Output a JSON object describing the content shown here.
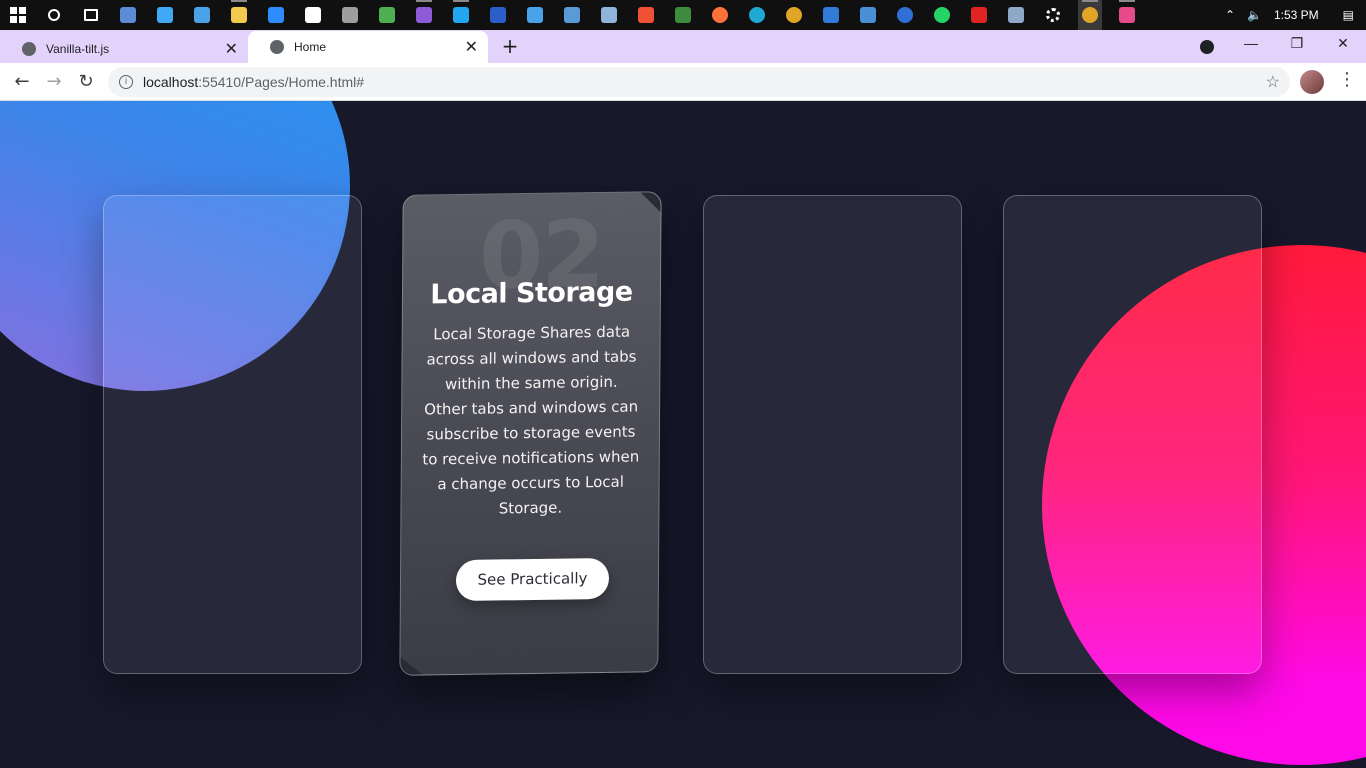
{
  "taskbar": {
    "apps": [
      {
        "icon": "search-icon",
        "color": "#ffffff"
      },
      {
        "icon": "task-view-icon",
        "color": "#ffffff"
      },
      {
        "icon": "calculator-icon",
        "color": "#5b8cd6"
      },
      {
        "icon": "desktop-icon",
        "color": "#3fa9f5"
      },
      {
        "icon": "control-panel-icon",
        "color": "#4aa3e8"
      },
      {
        "icon": "file-explorer-icon",
        "color": "#f2c94c"
      },
      {
        "icon": "zoom-icon",
        "color": "#2d8cff"
      },
      {
        "icon": "app-icon",
        "color": "#ffffff"
      },
      {
        "icon": "usb-icon",
        "color": "#9e9e9e"
      },
      {
        "icon": "paint-icon",
        "color": "#4caf50"
      },
      {
        "icon": "visual-studio-icon",
        "color": "#8e5bd6"
      },
      {
        "icon": "vscode-icon",
        "color": "#23a6f0"
      },
      {
        "icon": "visio-icon",
        "color": "#2b5fc7"
      },
      {
        "icon": "app-icon-2",
        "color": "#4aa3e8"
      },
      {
        "icon": "keyboard-icon",
        "color": "#5b9bd5"
      },
      {
        "icon": "notepad-icon",
        "color": "#8fb3d9"
      },
      {
        "icon": "git-icon",
        "color": "#f05033"
      },
      {
        "icon": "greenshot-icon",
        "color": "#3d8b3d"
      },
      {
        "icon": "firefox-icon",
        "color": "#ff7139"
      },
      {
        "icon": "edge-icon",
        "color": "#1fa8d1"
      },
      {
        "icon": "chrome-icon",
        "color": "#e0a526"
      },
      {
        "icon": "photos-icon",
        "color": "#2f7bd6"
      },
      {
        "icon": "screenshot-icon",
        "color": "#4a8fd6"
      },
      {
        "icon": "messenger-icon",
        "color": "#2f6fd6"
      },
      {
        "icon": "whatsapp-icon",
        "color": "#25d366"
      },
      {
        "icon": "acrobat-icon",
        "color": "#e02424"
      },
      {
        "icon": "remote-desktop-icon",
        "color": "#8fa8c8"
      },
      {
        "icon": "settings-icon",
        "color": "#ffffff"
      },
      {
        "icon": "chrome-icon-active",
        "color": "#e0a526"
      },
      {
        "icon": "paint3d-icon",
        "color": "#e64a8b"
      }
    ],
    "tray": {
      "chevron": "⌃",
      "volume": "🔈",
      "clock": "1:53 PM"
    }
  },
  "browser": {
    "tabs": [
      {
        "title": "Vanilla-tilt.js",
        "active": false
      },
      {
        "title": "Home",
        "active": true
      }
    ],
    "new_tab_label": "+",
    "url_host": "localhost",
    "url_path": ":55410/Pages/Home.html#",
    "window_controls": {
      "minimize": "—",
      "maximize": "❐",
      "close": "✕"
    }
  },
  "page": {
    "cards": [
      {
        "number": "",
        "title": "",
        "text": "",
        "button": ""
      },
      {
        "number": "02",
        "title": "Local Storage",
        "text": "Local Storage Shares data across all windows and tabs within the same origin. Other tabs and windows can subscribe to storage events to receive notifications when a change occurs to Local Storage.",
        "button": "See Practically"
      },
      {
        "number": "",
        "title": "",
        "text": "",
        "button": ""
      },
      {
        "number": "",
        "title": "",
        "text": "",
        "button": ""
      }
    ],
    "colors": {
      "background": "#17182a",
      "blue_blob": "#1e9af3",
      "pink_blob": "#ff1677",
      "magenta_blob": "#ff09e8"
    }
  }
}
